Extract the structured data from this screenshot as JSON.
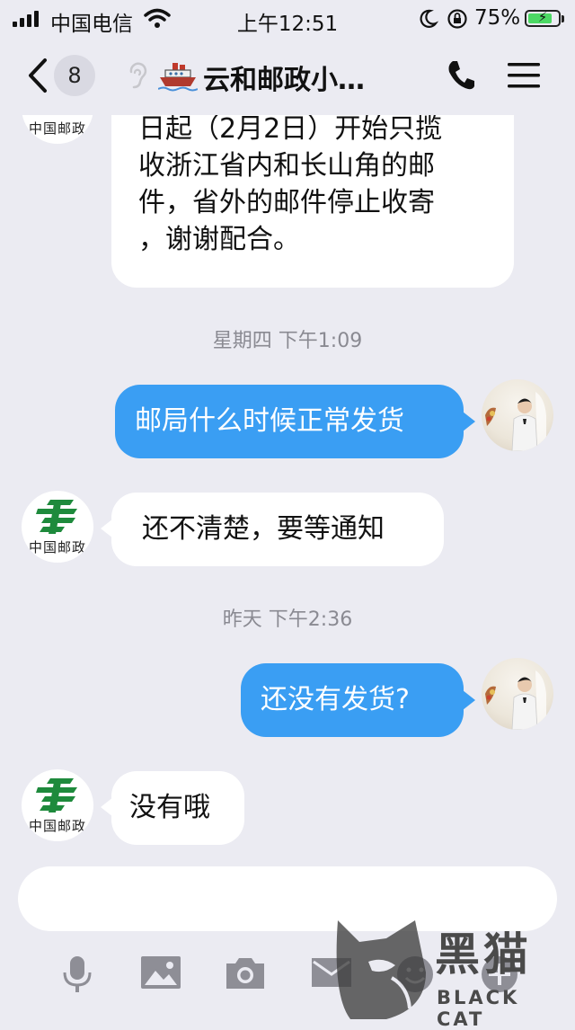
{
  "status_bar": {
    "carrier": "中国电信",
    "time": "上午12:51",
    "battery": "75%",
    "battery_level": 0.75
  },
  "nav": {
    "unread_count": "8",
    "title": "云和邮政小…",
    "icons": [
      "back-chevron-icon",
      "ear-icon",
      "ship-icon",
      "phone-icon",
      "menu-icon"
    ]
  },
  "messages": [
    {
      "side": "in",
      "lines": [
        "日起（2月2日）开始只揽",
        "收浙江省内和长山角的邮",
        "件，省外的邮件停止收寄",
        "，谢谢配合。"
      ]
    },
    {
      "type": "time",
      "text": "星期四 下午1:09"
    },
    {
      "side": "out",
      "text": "邮局什么时候正常发货"
    },
    {
      "side": "in",
      "text": "还不清楚，要等通知"
    },
    {
      "type": "time",
      "text": "昨天 下午2:36"
    },
    {
      "side": "out",
      "text": "还没有发货?"
    },
    {
      "side": "in",
      "text": "没有哦"
    }
  ],
  "avatars": {
    "post_label": "中国邮政"
  },
  "toolbar": {
    "icons": [
      "microphone-icon",
      "image-icon",
      "camera-icon",
      "envelope-icon",
      "emoji-icon",
      "plus-icon"
    ]
  },
  "watermark": {
    "title": "黑猫",
    "subtitle": "BLACK CAT"
  },
  "colors": {
    "background": "#ebebf2",
    "outgoing_bubble": "#3a9ef3",
    "incoming_bubble": "#ffffff",
    "post_green": "#1e8a3c"
  }
}
